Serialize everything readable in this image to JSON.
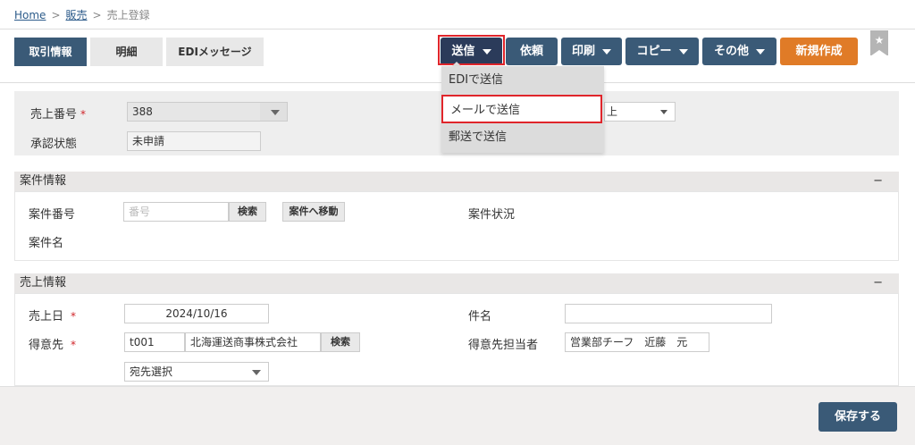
{
  "breadcrumb": {
    "home": "Home",
    "sales": "販売",
    "current": "売上登録",
    "sep": ">"
  },
  "tabs": {
    "transaction": "取引情報",
    "detail": "明細",
    "edi": "EDIメッセージ"
  },
  "toolbar": {
    "send": "送信",
    "request": "依頼",
    "print": "印刷",
    "copy": "コピー",
    "other": "その他",
    "new": "新規作成",
    "bookmark": "★"
  },
  "dropdown": {
    "items": [
      "EDIで送信",
      "メールで送信",
      "郵送で送信"
    ]
  },
  "header_form": {
    "sales_no_label": "売上番号",
    "sales_no_value": "388",
    "req_mark": "*",
    "approval_label": "承認状態",
    "approval_value": "未申請",
    "right_select_value": "上"
  },
  "project": {
    "title": "案件情報",
    "toggle": "−",
    "no_label": "案件番号",
    "no_placeholder": "番号",
    "search": "検索",
    "move": "案件へ移動",
    "status_label": "案件状況",
    "name_label": "案件名"
  },
  "sales": {
    "title": "売上情報",
    "toggle": "−",
    "date_label": "売上日",
    "date_value": "2024/10/16",
    "subject_label": "件名",
    "subject_value": "",
    "customer_label": "得意先",
    "customer_code": "t001",
    "customer_name": "北海運送商事株式会社",
    "search": "検索",
    "contact_label": "得意先担当者",
    "contact_value": "営業部チーフ　近藤　元",
    "destination": "宛先選択"
  },
  "footer": {
    "save": "保存する"
  }
}
